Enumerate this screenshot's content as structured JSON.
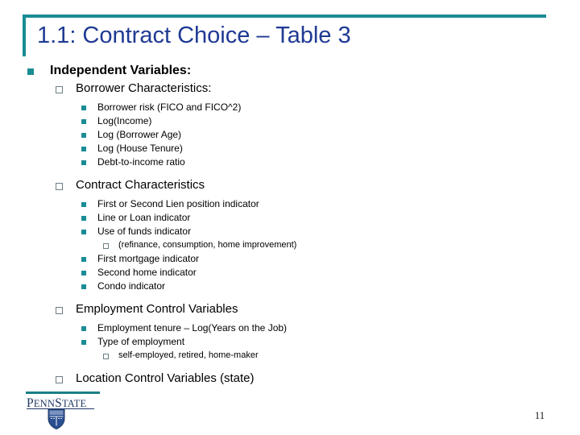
{
  "slide": {
    "title": "1.1: Contract Choice – Table 3",
    "page_number": "11",
    "accent_color": "#1a8c94",
    "title_color": "#1f3a93"
  },
  "logo": {
    "word_penn": "PENN",
    "word_s": "S",
    "word_tate": "TATE",
    "name": "penn-state-logo"
  },
  "outline": {
    "heading": "Independent Variables:",
    "groups": [
      {
        "heading": "Borrower Characteristics:",
        "items": [
          {
            "text": "Borrower risk (FICO and FICO^2)"
          },
          {
            "text": "Log(Income)"
          },
          {
            "text": "Log (Borrower Age)"
          },
          {
            "text": "Log (House Tenure)"
          },
          {
            "text": "Debt-to-income ratio"
          }
        ]
      },
      {
        "heading": "Contract Characteristics",
        "items": [
          {
            "text": "First or Second Lien position indicator"
          },
          {
            "text": "Line or Loan indicator"
          },
          {
            "text": "Use of funds indicator"
          },
          {
            "text": "(refinance, consumption, home improvement)",
            "sub": true
          },
          {
            "text": "First mortgage indicator"
          },
          {
            "text": "Second home indicator"
          },
          {
            "text": "Condo indicator"
          }
        ]
      },
      {
        "heading": "Employment Control Variables",
        "items": [
          {
            "text": "Employment tenure – Log(Years on the Job)"
          },
          {
            "text": "Type of employment"
          },
          {
            "text": "self-employed, retired, home-maker",
            "sub": true
          }
        ]
      },
      {
        "heading": "Location  Control Variables (state)",
        "items": []
      }
    ]
  }
}
